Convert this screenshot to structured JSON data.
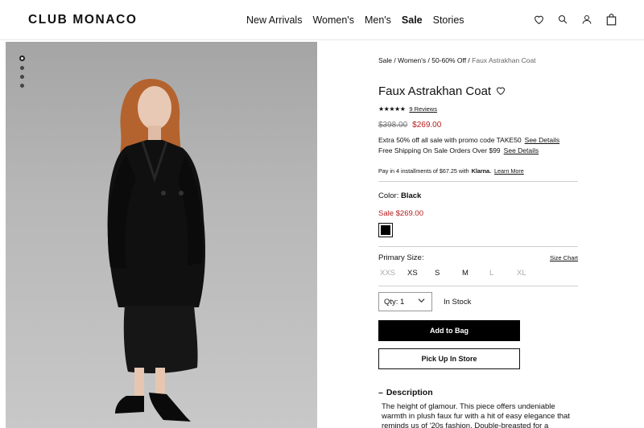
{
  "brand": {
    "logo": "CLUB MONACO"
  },
  "nav": [
    "New Arrivals",
    "Women's",
    "Men's",
    "Sale",
    "Stories"
  ],
  "header_icons": [
    "heart-icon",
    "search-icon",
    "user-icon",
    "bag-icon"
  ],
  "gallery": {
    "dots": 4,
    "active": 0
  },
  "breadcrumb": {
    "links": [
      "Sale",
      "Women's",
      "50-60% Off"
    ],
    "current": "Faux Astrakhan Coat"
  },
  "product": {
    "title": "Faux Astrakhan Coat",
    "rating_stars": "★★★★★",
    "rating_value": 5,
    "reviews": "9 Reviews",
    "original_price": "$398.00",
    "sale_price": "$269.00",
    "promo1": "Extra 50% off all sale with promo code TAKE50",
    "promo1_link": "See Details",
    "promo2": "Free Shipping On Sale Orders Over $99",
    "promo2_link": "See Details",
    "klarna_text": "Pay in 4 installments of $67.25 with",
    "klarna_brand": "Klarna.",
    "klarna_link": "Learn More",
    "color_label": "Color:",
    "color_value": "Black",
    "color_sale": "Sale $269.00",
    "size_label": "Primary Size:",
    "size_chart": "Size Chart",
    "sizes": [
      {
        "label": "XXS",
        "available": false
      },
      {
        "label": "XS",
        "available": true
      },
      {
        "label": "S",
        "available": true
      },
      {
        "label": "M",
        "available": true
      },
      {
        "label": "L",
        "available": false
      },
      {
        "label": "XL",
        "available": false
      }
    ],
    "qty_label": "Qty: 1",
    "stock": "In Stock",
    "add_to_bag": "Add to Bag",
    "pick_up": "Pick Up In Store",
    "desc_toggle": "–",
    "desc_title": "Description",
    "desc_text": "The height of glamour. This piece offers undeniable warmth in plush faux fur with a hit of easy elegance that reminds us of '20s fashion. Double-breasted for a relaxed"
  },
  "colors": {
    "sale_red": "#b51c1c",
    "black": "#000000"
  }
}
